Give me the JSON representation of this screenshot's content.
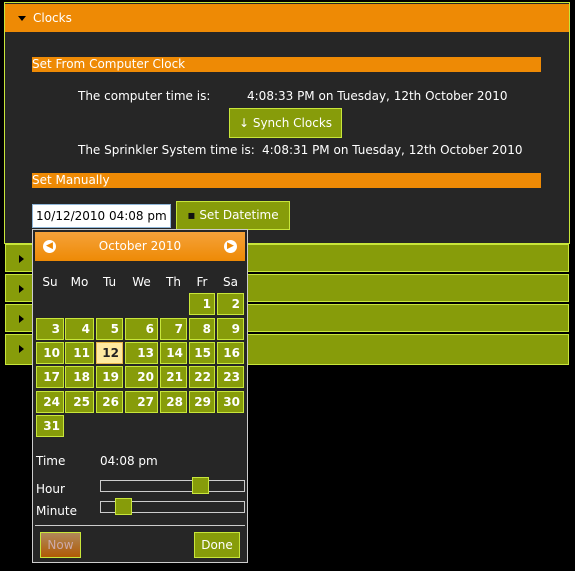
{
  "clocks": {
    "title": "Clocks",
    "from_computer": {
      "heading": "Set From Computer Clock",
      "computer_label": "The computer time is:",
      "computer_value": "4:08:33 PM on Tuesday, 12th October 2010",
      "synch_label": "Synch Clocks",
      "sprinkler_label": "The Sprinkler System time is:",
      "sprinkler_value": "4:08:31 PM on Tuesday, 12th October 2010"
    },
    "manual": {
      "heading": "Set Manually",
      "datetime_value": "10/12/2010 04:08 pm",
      "set_label": "Set Datetime"
    }
  },
  "collapsed_sections": 4,
  "datepicker": {
    "month_label": "October 2010",
    "day_names": [
      "Su",
      "Mo",
      "Tu",
      "We",
      "Th",
      "Fr",
      "Sa"
    ],
    "first_weekday": 5,
    "days_in_month": 31,
    "selected_day": 12,
    "time_label": "Time",
    "time_value": "04:08 pm",
    "hour_label": "Hour",
    "minute_label": "Minute",
    "hour": 16,
    "hour_max": 23,
    "minute": 8,
    "minute_max": 59,
    "now_label": "Now",
    "done_label": "Done"
  },
  "colors": {
    "accent": "#ee8a05",
    "green": "#879c0a",
    "border": "#c8e63a"
  }
}
